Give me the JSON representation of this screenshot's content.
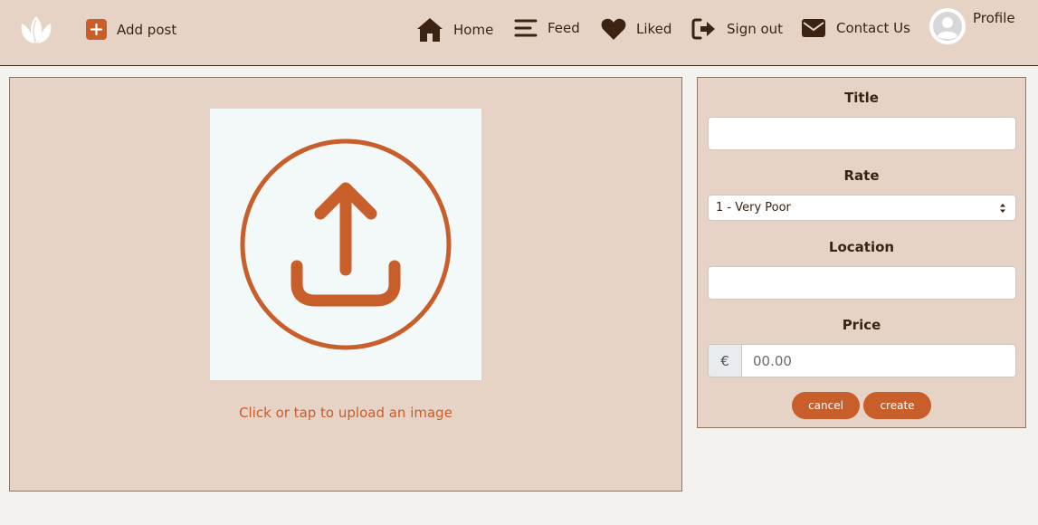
{
  "nav": {
    "add_post": "Add post",
    "home": "Home",
    "feed": "Feed",
    "liked": "Liked",
    "sign_out": "Sign out",
    "contact": "Contact Us",
    "profile": "Profile"
  },
  "icons": {
    "logo": "lotus-logo-icon",
    "add_post": "plus-square-icon",
    "home": "home-icon",
    "feed": "menu-lines-icon",
    "liked": "heart-icon",
    "sign_out": "sign-out-icon",
    "contact": "envelope-icon",
    "profile": "user-avatar-icon",
    "upload": "upload-circle-icon"
  },
  "upload": {
    "hint": "Click or tap to upload an image"
  },
  "form": {
    "title_label": "Title",
    "title_value": "",
    "rate_label": "Rate",
    "rate_selected": "1 - Very Poor",
    "location_label": "Location",
    "location_value": "",
    "price_label": "Price",
    "currency": "€",
    "price_placeholder": "00.00",
    "cancel": "cancel",
    "create": "create"
  },
  "colors": {
    "accent": "#c85e2a",
    "panel": "#e6d3c5",
    "text": "#3b2314",
    "background": "#f3f2ee"
  }
}
